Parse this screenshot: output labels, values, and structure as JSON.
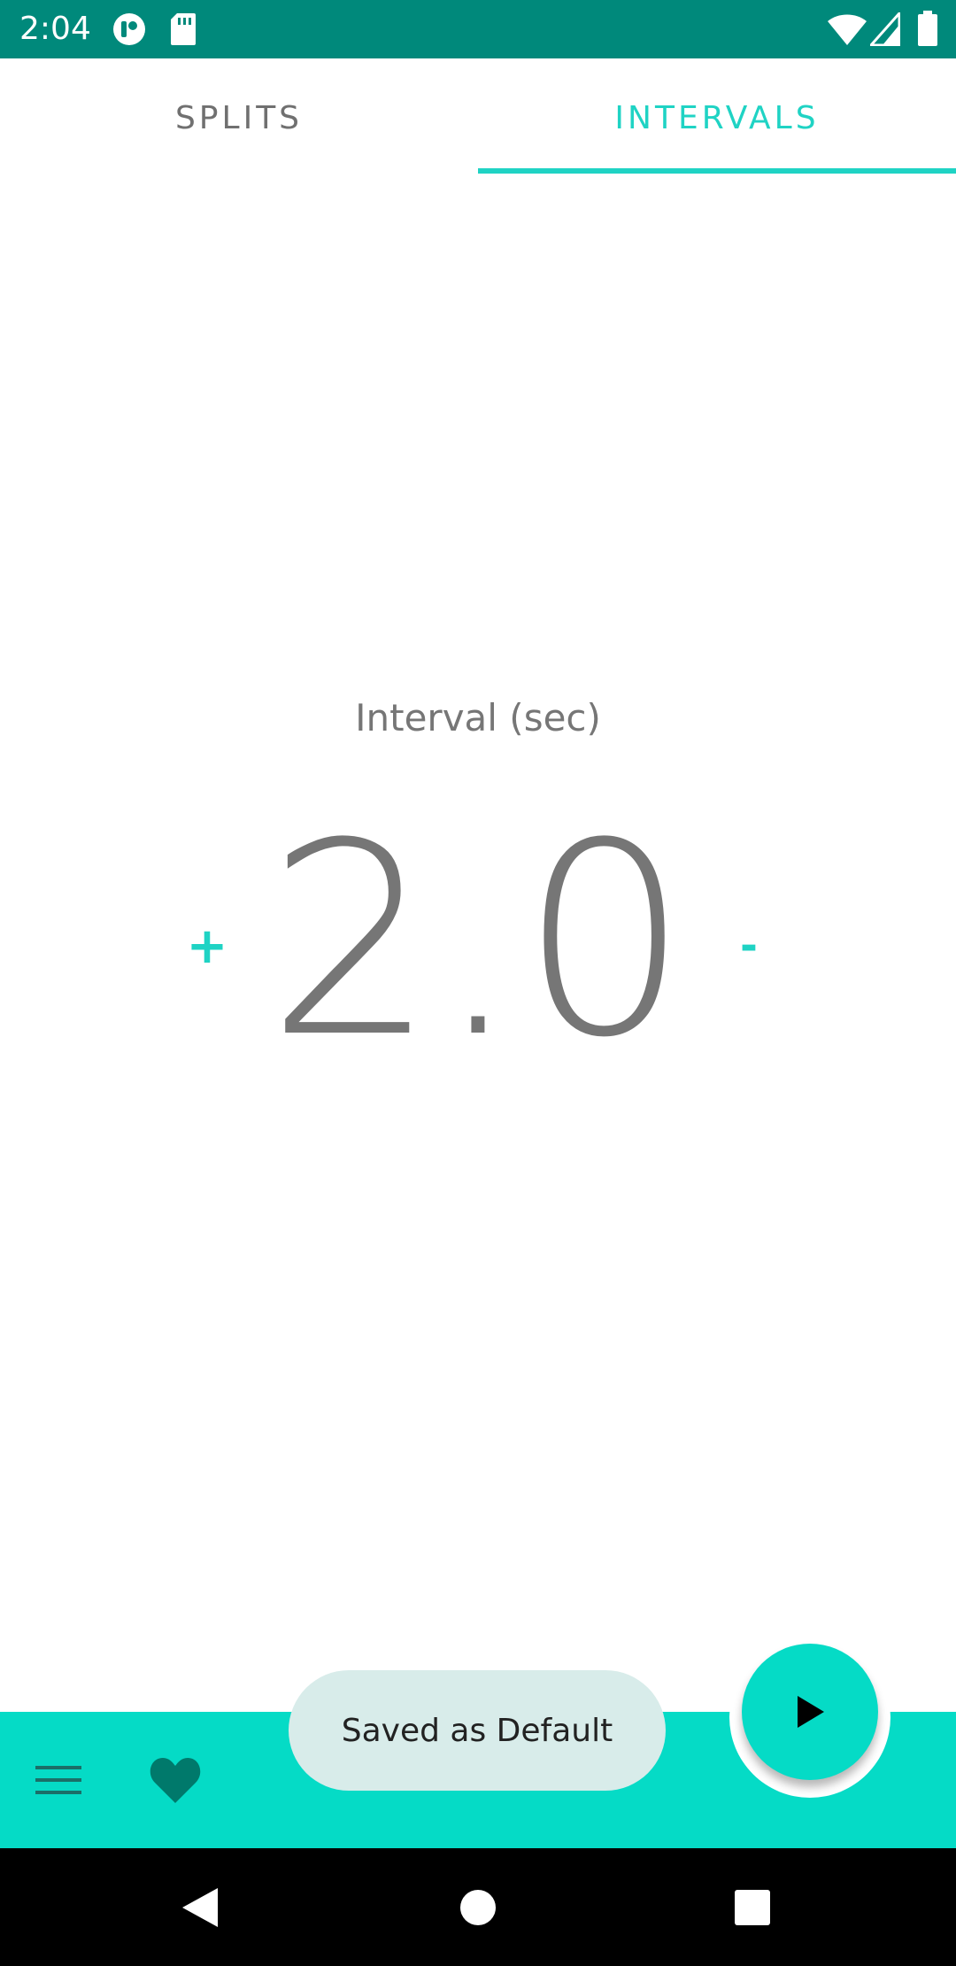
{
  "status_bar": {
    "time": "2:04",
    "left_icons": [
      "app-notification-icon",
      "sd-card-icon"
    ],
    "right_icons": [
      "wifi-icon",
      "cell-signal-icon",
      "battery-icon"
    ],
    "background": "#00897b"
  },
  "tabs": [
    {
      "label": "SPLITS",
      "selected": false
    },
    {
      "label": "INTERVALS",
      "selected": true
    }
  ],
  "main": {
    "label": "Interval (sec)",
    "value": "2.0",
    "increment_label": "+",
    "decrement_label": "-"
  },
  "bottom_bar": {
    "icons": [
      "menu-icon",
      "heart-icon"
    ],
    "fab_icon": "play-icon",
    "color": "#05dbc6"
  },
  "toast": {
    "text": "Saved as Default"
  },
  "nav_bar": {
    "icons": [
      "back-icon",
      "home-icon",
      "recents-icon"
    ]
  },
  "colors": {
    "accent": "#1fd3c4",
    "primary_dark": "#00897b",
    "text_gray": "#767676"
  }
}
